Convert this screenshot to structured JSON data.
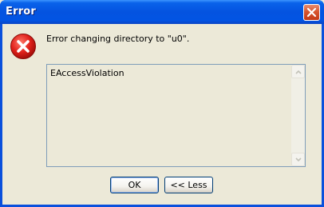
{
  "window": {
    "title": "Error"
  },
  "dialog": {
    "message": "Error changing directory to \"u0\".",
    "details": "EAccessViolation",
    "icon": "error-icon"
  },
  "buttons": {
    "ok_label": "OK",
    "less_label": "<< Less"
  },
  "colors": {
    "titlebar": "#0453e0",
    "close_button": "#d8552f",
    "dialog_background": "#ece9d8",
    "error_icon": "#e0201a"
  }
}
